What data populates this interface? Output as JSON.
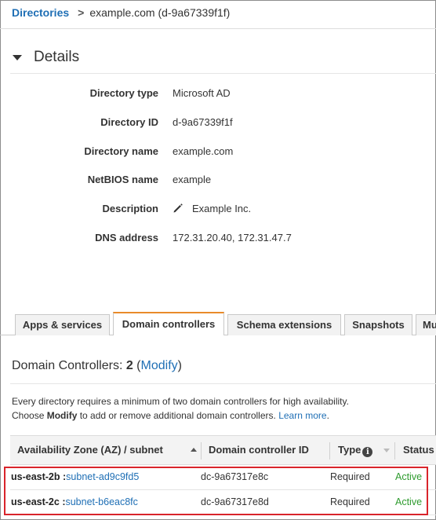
{
  "breadcrumb": {
    "root": "Directories",
    "separator": ">",
    "current": "example.com (d-9a67339f1f)"
  },
  "details": {
    "title": "Details",
    "rows": [
      {
        "label": "Directory type",
        "value": "Microsoft AD"
      },
      {
        "label": "Directory ID",
        "value": "d-9a67339f1f"
      },
      {
        "label": "Directory name",
        "value": "example.com"
      },
      {
        "label": "NetBIOS name",
        "value": "example"
      },
      {
        "label": "Description",
        "value": "Example Inc."
      },
      {
        "label": "DNS address",
        "value": "172.31.20.40, 172.31.47.7"
      }
    ]
  },
  "tabs": [
    {
      "label": "Apps & services"
    },
    {
      "label": "Domain controllers",
      "active": true
    },
    {
      "label": "Schema extensions"
    },
    {
      "label": "Snapshots"
    },
    {
      "label": "Mu"
    }
  ],
  "domain_controllers": {
    "heading_prefix": "Domain Controllers: ",
    "count": "2",
    "open_paren": " (",
    "modify_link": "Modify",
    "close_paren": ")",
    "note_line1": "Every directory requires a minimum of two domain controllers for high availability.",
    "note_line2_pre": "Choose ",
    "note_line2_bold": "Modify",
    "note_line2_post": " to add or remove additional domain controllers. ",
    "learn_more": "Learn more",
    "note_end": "."
  },
  "table": {
    "columns": [
      "Availability Zone (AZ) / subnet",
      "Domain controller ID",
      "Type",
      "Status"
    ],
    "rows": [
      {
        "az": "us-east-2b",
        "sep": " :",
        "subnet": "subnet-ad9c9fd5",
        "dc_id": "dc-9a67317e8c",
        "type": "Required",
        "status": "Active"
      },
      {
        "az": "us-east-2c",
        "sep": " :",
        "subnet": "subnet-b6eac8fc",
        "dc_id": "dc-9a67317e8d",
        "type": "Required",
        "status": "Active"
      }
    ]
  },
  "colors": {
    "link": "#1f6fb5",
    "active_tab_accent": "#e98b2a",
    "status_active": "#2e9b2e",
    "highlight_border": "#d9242b"
  }
}
